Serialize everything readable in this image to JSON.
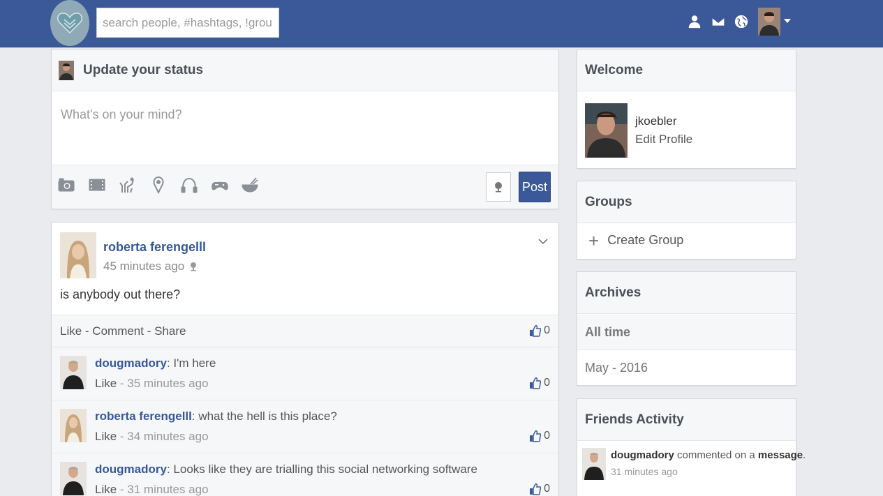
{
  "header": {
    "search_placeholder": "search people, #hashtags, !groups",
    "icons": [
      "friend-requests-icon",
      "messages-icon",
      "notifications-globe-icon"
    ],
    "brand_color": "#3b5998"
  },
  "status": {
    "title": "Update your status",
    "placeholder": "What's on your mind?",
    "tools": [
      "camera-icon",
      "video-icon",
      "mood-icon",
      "location-icon",
      "music-icon",
      "game-icon",
      "food-icon"
    ],
    "post_label": "Post"
  },
  "post": {
    "author": "roberta ferengelll",
    "time": "45 minutes ago",
    "body": "is anybody out there?",
    "actions": {
      "like": "Like",
      "sep1": " - ",
      "comment": "Comment",
      "sep2": " - ",
      "share": "Share"
    },
    "like_count": "0",
    "comments": [
      {
        "user": "dougmadory",
        "sep": ": ",
        "text": "I'm here",
        "like": "Like",
        "time_sep": " - ",
        "time": "35 minutes ago",
        "likes": "0"
      },
      {
        "user": "roberta ferengelll",
        "sep": ": ",
        "text": "what the hell is this place?",
        "like": "Like",
        "time_sep": " - ",
        "time": "34 minutes ago",
        "likes": "0"
      },
      {
        "user": "dougmadory",
        "sep": ": ",
        "text": "Looks like they are trialling this social networking software",
        "like": "Like",
        "time_sep": " - ",
        "time": "31 minutes ago",
        "likes": "0"
      }
    ]
  },
  "welcome": {
    "title": "Welcome",
    "username": "jkoebler",
    "edit": "Edit Profile"
  },
  "groups": {
    "title": "Groups",
    "plus": "+",
    "create": "Create Group"
  },
  "archives": {
    "title": "Archives",
    "items": [
      "All time",
      "May - 2016"
    ]
  },
  "friends_activity": {
    "title": "Friends Activity",
    "items": [
      {
        "user": "dougmadory",
        "action": " commented on a ",
        "object": "message",
        "end": ".",
        "time": "31 minutes ago"
      }
    ]
  }
}
